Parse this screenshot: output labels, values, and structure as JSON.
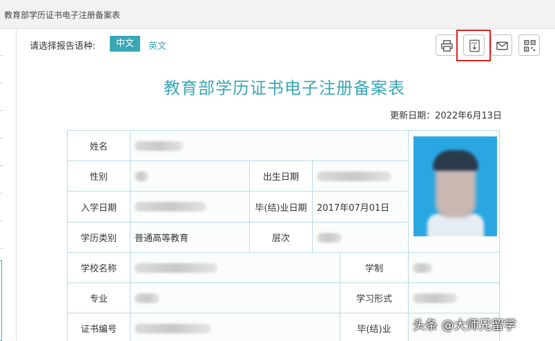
{
  "window": {
    "title": "教育部学历证书电子注册备案表"
  },
  "language": {
    "label": "请选择报告语种:",
    "options": [
      "中文",
      "英文"
    ],
    "selected": "中文"
  },
  "toolbar": {
    "buttons": [
      "print-icon",
      "pdf-download-icon",
      "mail-icon",
      "qrcode-icon"
    ],
    "highlight_color": "#e02020"
  },
  "document": {
    "title": "教育部学历证书电子注册备案表",
    "update_date": "更新日期：2022年6月13日"
  },
  "form": {
    "name_label": "姓名",
    "gender_label": "性别",
    "birth_label": "出生日期",
    "enroll_label": "入学日期",
    "grad_label": "毕(结)业日期",
    "grad_value": "2017年07月01日",
    "edu_type_label": "学历类别",
    "edu_type_value": "普通高等教育",
    "level_label": "层次",
    "school_label": "学校名称",
    "duration_label": "学制",
    "major_label": "专业",
    "study_form_label": "学习形式",
    "cert_no_label": "证书编号",
    "grad_status_label": "毕(结)业"
  },
  "watermark": "头条 @大师兄留学",
  "colors": {
    "accent": "#3aa7b5",
    "border": "#b7dce2"
  }
}
